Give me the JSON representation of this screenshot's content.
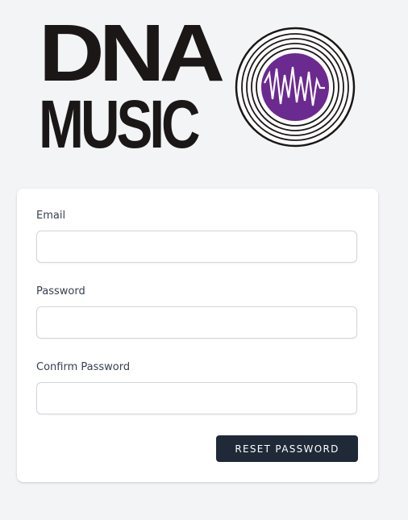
{
  "logo": {
    "line1": "DNA",
    "line2": "MUSIC",
    "record_color": "#6b2a8f",
    "text_color": "#1b1717"
  },
  "form": {
    "fields": [
      {
        "label": "Email",
        "value": "",
        "type": "email"
      },
      {
        "label": "Password",
        "value": "",
        "type": "password"
      },
      {
        "label": "Confirm Password",
        "value": "",
        "type": "password"
      }
    ],
    "submit_label": "RESET PASSWORD"
  },
  "colors": {
    "background": "#f3f4f6",
    "card": "#ffffff",
    "button": "#1f2937",
    "input_border": "#d1d5db"
  }
}
